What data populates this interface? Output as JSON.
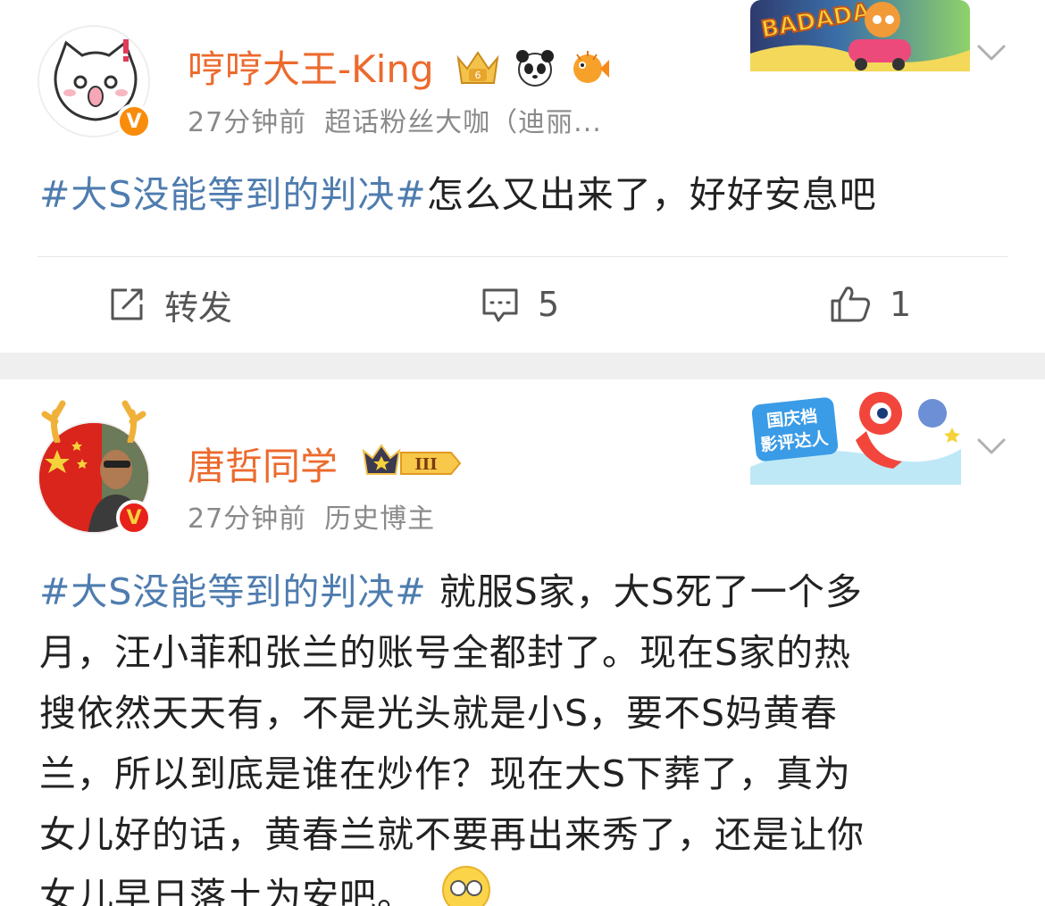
{
  "posts": [
    {
      "username": "哼哼大王-King",
      "time": "27分钟前",
      "source": "超话粉丝大咖（迪丽...",
      "topic": "#大S没能等到的判决#",
      "body": "怎么又出来了，好好安息吧",
      "repost_label": "转发",
      "comment_count": "5",
      "like_count": "1",
      "sticker_text": "BADADA",
      "verified": "V"
    },
    {
      "username": "唐哲同学",
      "time": "27分钟前",
      "source": "历史博主",
      "topic": "#大S没能等到的判决#",
      "body_lines": [
        " 就服S家，大S死了一个多",
        "月，汪小菲和张兰的账号全都封了。现在S家的热",
        "搜依然天天有，不是光头就是小S，要不S妈黄春",
        "兰，所以到底是谁在炒作？现在大S下葬了，真为",
        "女儿好的话，黄春兰就不要再出来秀了，还是让你",
        "女儿早日落土为安吧。"
      ],
      "rank_badge": "III",
      "sticker_text": "国庆档\n影评达人",
      "verified": "V"
    }
  ],
  "colors": {
    "username": "#ec6a2d",
    "topic": "#4e7caf",
    "meta": "#8a8a8a"
  }
}
